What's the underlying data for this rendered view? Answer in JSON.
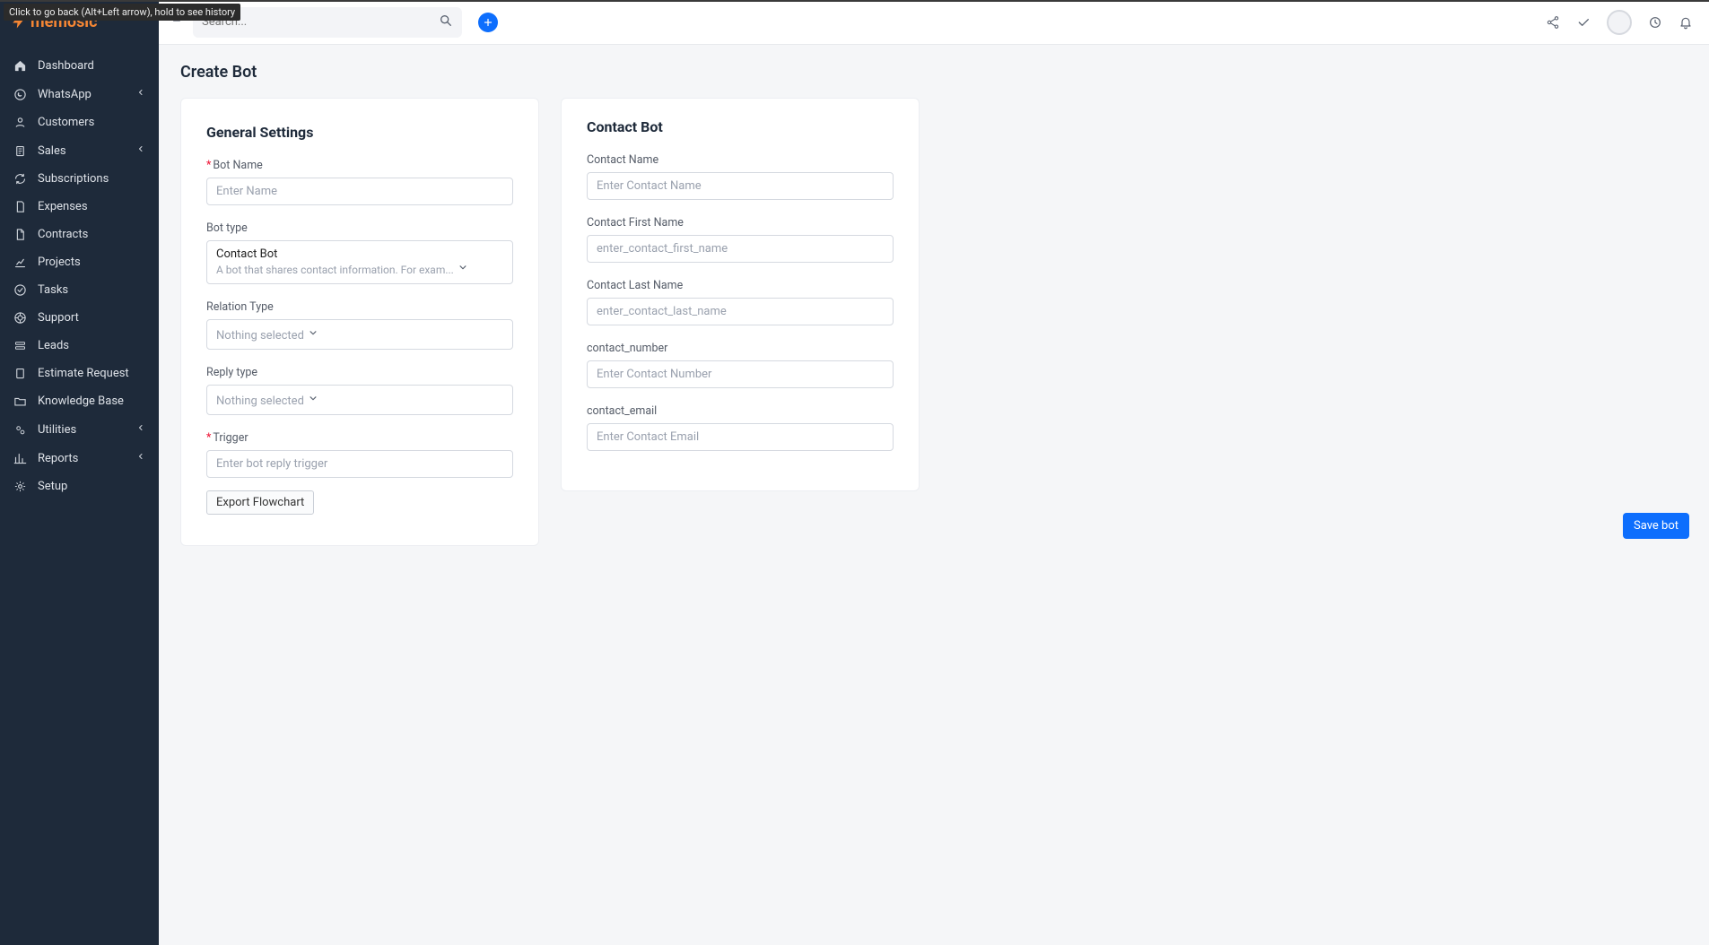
{
  "tooltip_back": "Click to go back (Alt+Left arrow), hold to see history",
  "logo_text": "memosic",
  "search": {
    "placeholder": "Search..."
  },
  "sidebar": {
    "items": [
      {
        "label": "Dashboard",
        "icon": "home"
      },
      {
        "label": "WhatsApp",
        "icon": "whatsapp",
        "expandable": true
      },
      {
        "label": "Customers",
        "icon": "user"
      },
      {
        "label": "Sales",
        "icon": "receipt",
        "expandable": true
      },
      {
        "label": "Subscriptions",
        "icon": "refresh"
      },
      {
        "label": "Expenses",
        "icon": "doc"
      },
      {
        "label": "Contracts",
        "icon": "file"
      },
      {
        "label": "Projects",
        "icon": "chart"
      },
      {
        "label": "Tasks",
        "icon": "check"
      },
      {
        "label": "Support",
        "icon": "life"
      },
      {
        "label": "Leads",
        "icon": "leads"
      },
      {
        "label": "Estimate Request",
        "icon": "doc2"
      },
      {
        "label": "Knowledge Base",
        "icon": "folder"
      },
      {
        "label": "Utilities",
        "icon": "cog",
        "expandable": true
      },
      {
        "label": "Reports",
        "icon": "bar",
        "expandable": true
      },
      {
        "label": "Setup",
        "icon": "gear"
      }
    ]
  },
  "page": {
    "title": "Create Bot"
  },
  "general": {
    "title": "General Settings",
    "bot_name": {
      "label": "Bot Name",
      "placeholder": "Enter Name",
      "required": true
    },
    "bot_type": {
      "label": "Bot type",
      "selected": "Contact Bot",
      "desc": "A bot that shares contact information. For exam..."
    },
    "relation_type": {
      "label": "Relation Type",
      "placeholder": "Nothing selected"
    },
    "reply_type": {
      "label": "Reply type",
      "placeholder": "Nothing selected"
    },
    "trigger": {
      "label": "Trigger",
      "placeholder": "Enter bot reply trigger",
      "required": true
    },
    "export_label": "Export Flowchart"
  },
  "contact": {
    "title": "Contact Bot",
    "name": {
      "label": "Contact Name",
      "placeholder": "Enter Contact Name"
    },
    "first": {
      "label": "Contact First Name",
      "placeholder": "enter_contact_first_name"
    },
    "last": {
      "label": "Contact Last Name",
      "placeholder": "enter_contact_last_name"
    },
    "number": {
      "label": "contact_number",
      "placeholder": "Enter Contact Number"
    },
    "email": {
      "label": "contact_email",
      "placeholder": "Enter Contact Email"
    }
  },
  "save_label": "Save bot"
}
